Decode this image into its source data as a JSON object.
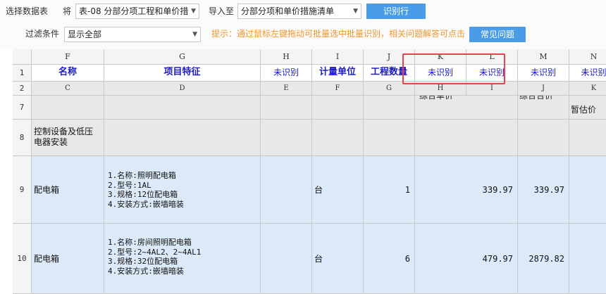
{
  "toolbar": {
    "select_table_label": "选择数据表",
    "to_label": "将",
    "table_select_value": "表-08 分部分项工程和单价措",
    "import_label": "导入至",
    "import_select_value": "分部分项和单价措施清单",
    "identify_button": "识别行",
    "filter_label": "过滤条件",
    "filter_select_value": "显示全部",
    "hint": "提示：通过鼠标左键拖动可批量选中批量识别，相关问题解答可点击",
    "faq_button": "常见问题"
  },
  "columns": {
    "excel": [
      "F",
      "G",
      "H",
      "I",
      "J",
      "K",
      "L",
      "M",
      "N"
    ],
    "titles": [
      "名称",
      "项目特征",
      "未识别",
      "计量单位",
      "工程数量",
      "未识别",
      "未识别",
      "未识别",
      "未识别"
    ],
    "source": [
      "C",
      "D",
      "E",
      "F",
      "G",
      "H",
      "I",
      "J",
      "K"
    ]
  },
  "row_numbers": [
    "1",
    "2",
    "7",
    "8",
    "9",
    "10"
  ],
  "rows": {
    "r7": {
      "k_fragment": "综合单价",
      "m_fragment": "综合合价",
      "n_text": "暂估价"
    },
    "r8": {
      "name": "控制设备及低压\n电器安装"
    },
    "r9": {
      "name": "配电箱",
      "features": "1.名称:照明配电箱\n2.型号:1AL\n3.规格:12位配电箱\n4.安装方式:嵌墙暗装",
      "unit": "台",
      "quantity": "1",
      "unit_price": "339.97",
      "total": "339.97"
    },
    "r10": {
      "name": "配电箱",
      "features": "1.名称:房间照明配电箱\n2.型号:2~4AL2、2~4AL1\n3.规格:32位配电箱\n4.安装方式:嵌墙暗装",
      "unit": "台",
      "quantity": "6",
      "unit_price": "479.97",
      "total": "2879.82"
    }
  },
  "colors": {
    "accent_button": "#4a9ce8",
    "hint_text": "#f0962e",
    "title_text": "#1c1cc4",
    "highlight_box": "#e8434a",
    "data_row_bg": "#dce9f8",
    "group_row_bg": "#e8e8e8"
  },
  "icons": {
    "dropdown": "chevron-down-icon"
  }
}
